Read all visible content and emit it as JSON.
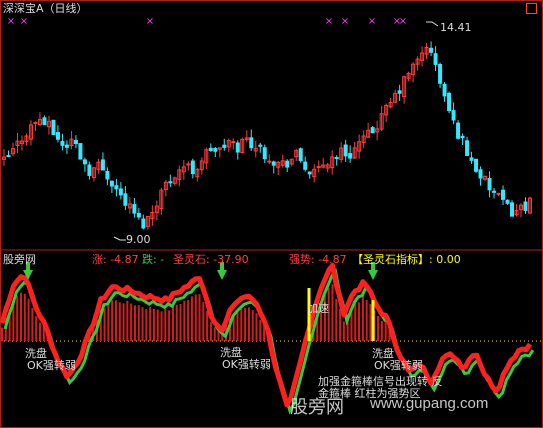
{
  "colors": {
    "up": "#ff3c3c",
    "down": "#35e8ff",
    "green": "#3cc83c",
    "yellow": "#ffff00",
    "white": "#dcdcdc",
    "magenta": "#ff40ff",
    "grid": "#b01e1e",
    "dotted": "#ffd060"
  },
  "header": {
    "title": "深深宝A（日线）",
    "close_icon": "close-square-icon"
  },
  "main_chart": {
    "high_label": "14.41",
    "low_label": "9.00",
    "marker_glyph": "×",
    "marker_count": 8
  },
  "indicator": {
    "name_label": "股旁网",
    "rise_label": "涨: -4.87",
    "fall_label": "跌: -",
    "stone_label": "圣灵石: -37.90",
    "strength_label": "强势: -4.87",
    "indicator_name_label": "【圣灵石指标】: 0.00",
    "arrow_icon": "down-arrow-icon",
    "annotations": [
      {
        "id": "a1",
        "text": "洗盘"
      },
      {
        "id": "a2",
        "text": "OK强转弱"
      },
      {
        "id": "a3",
        "text": "洗盘"
      },
      {
        "id": "a4",
        "text": "OK强转弱"
      },
      {
        "id": "a5",
        "text": "加速"
      },
      {
        "id": "a6",
        "text": "洗盘"
      },
      {
        "id": "a7",
        "text": "OK强转弱"
      },
      {
        "id": "a8",
        "text": "加强金箍棒信号出现转 反"
      },
      {
        "id": "a9",
        "text": "金箍棒 红柱为强势区"
      }
    ]
  },
  "watermark": {
    "text_cn": "股旁网",
    "text_url": "www.gupang.com"
  },
  "chart_data": [
    {
      "type": "candlestick",
      "title": "深深宝A（日线）",
      "high": 14.41,
      "low": 9.0,
      "ylim": [
        8.4,
        15.2
      ],
      "price_path": [
        10.9,
        11.2,
        11.6,
        11.9,
        12.2,
        12.0,
        11.7,
        11.3,
        11.6,
        11.0,
        10.6,
        10.8,
        10.5,
        10.1,
        9.7,
        9.4,
        9.0,
        9.3,
        9.9,
        10.3,
        10.6,
        10.8,
        10.6,
        11.0,
        11.3,
        11.2,
        11.5,
        11.3,
        11.6,
        11.4,
        11.2,
        11.0,
        10.8,
        10.9,
        11.1,
        10.7,
        10.5,
        10.8,
        11.0,
        11.2,
        11.1,
        11.4,
        11.6,
        11.9,
        12.3,
        12.7,
        13.1,
        13.6,
        13.9,
        14.41,
        13.8,
        12.9,
        12.1,
        11.6,
        11.0,
        10.6,
        10.2,
        9.9,
        9.6,
        9.4,
        9.5,
        9.7
      ]
    },
    {
      "type": "area",
      "title": "圣灵石指标",
      "series": [
        {
          "name": "圣灵石",
          "values": [
            -37.9
          ]
        },
        {
          "name": "强势",
          "values": [
            -4.87
          ]
        },
        {
          "name": "圣灵石指标",
          "values": [
            0.0
          ]
        }
      ],
      "indicator_path": [
        20,
        62,
        75,
        40,
        15,
        -20,
        -40,
        -20,
        10,
        45,
        60,
        58,
        55,
        50,
        48,
        45,
        55,
        62,
        72,
        30,
        10,
        40,
        50,
        45,
        20,
        -35,
        -78,
        -30,
        20,
        60,
        85,
        30,
        55,
        65,
        40,
        25,
        -10,
        -35,
        -25,
        -45,
        -20,
        -15,
        -30,
        -10,
        -40,
        -55,
        -25,
        -10,
        -5
      ]
    }
  ]
}
